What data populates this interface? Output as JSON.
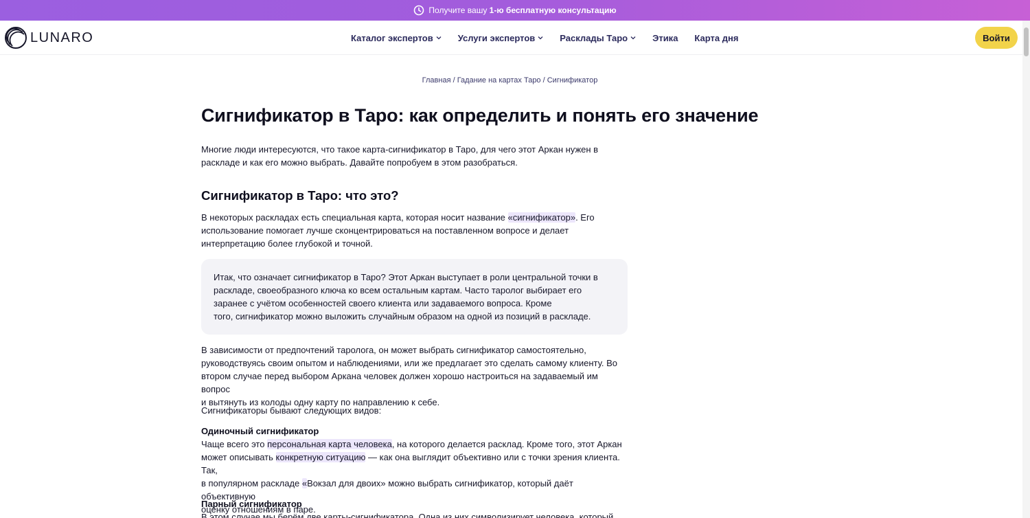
{
  "promo": {
    "prefix": "Получите вашу ",
    "bold": "1-ю бесплатную консультацию"
  },
  "header": {
    "logo_text": "LUNARO",
    "nav": [
      {
        "label": "Каталог экспертов",
        "dropdown": true
      },
      {
        "label": "Услуги экспертов",
        "dropdown": true
      },
      {
        "label": "Расклады Таро",
        "dropdown": true
      },
      {
        "label": "Этика",
        "dropdown": false
      },
      {
        "label": "Карта дня",
        "dropdown": false
      }
    ],
    "login_label": "Войти"
  },
  "breadcrumb": {
    "items": [
      "Главная",
      "Гадание на картах Таро",
      "Сигнификатор"
    ],
    "separator": " / "
  },
  "article": {
    "title": "Сигнификатор в Таро: как определить и понять его значение",
    "intro_1": "Многие люди интересуются, что такое карта-сигнификатор в Таро, для чего этот Аркан нужен в",
    "intro_2": "раскладе и как его можно выбрать. Давайте попробуем в этом разобраться.",
    "h2": "Сигнификатор в Таро: что это?",
    "p1_a": "В некоторых раскладах есть специальная карта, которая носит название ",
    "p1_hl": "«сигнификатор»",
    "p1_b": ". Его",
    "p1_2": "использование помогает лучше сконцентрироваться на поставленном вопросе и делает",
    "p1_3": "интерпретацию более глубокой и точной.",
    "callout_1": "Итак, что означает сигнификатор в Таро? Этот Аркан выступает в роли центральной точки в",
    "callout_2": "раскладе, своеобразного ключа ко всем остальным картам. Часто таролог выбирает его",
    "callout_3": "заранее с учётом особенностей своего клиента или задаваемого вопроса. Кроме",
    "callout_4": "того, сигнификатор можно выложить случайным образом на одной из позиций в раскладе.",
    "p2_1": "В зависимости от предпочтений таролога, он может выбрать сигнификатор самостоятельно,",
    "p2_2": "руководствуясь своим опытом и наблюдениями, или же предлагает это сделать самому клиенту. Во",
    "p2_3": "втором случае перед выбором Аркана человек должен хорошо настроиться на задаваемый им вопрос",
    "p2_4": "и вытянуть из колоды одну карту по направлению к себе.",
    "p3": "Сигнификаторы бывают следующих видов:",
    "sub1": "Одиночный сигнификатор",
    "s1_1a": "Чаще всего это ",
    "s1_1hl": "персональная карта человека",
    "s1_1b": ", на которого делается расклад. Кроме того, этот Аркан",
    "s1_2a": "может описывать ",
    "s1_2hl": "конкретную ситуацию",
    "s1_2b": " — как она выглядит объективно или с точки зрения клиента. Так,",
    "s1_3a": "в популярном раскладе ",
    "s1_3hl": "«",
    "s1_3b": "Вокзал для двоих» можно выбрать сигнификатор, который даёт объективную",
    "s1_4": "оценку отношениям в паре.",
    "sub2": "Парный сигнификатор",
    "s2_1": "В этом случае мы берём две карты-сигнификатора. Одна из них символизирует человека, который"
  },
  "colors": {
    "promo_gradient": [
      "#9b5fe0",
      "#c760d6"
    ],
    "login_button": "#f2d34a",
    "nav_text": "#2b2a5c",
    "highlight": "#ece6fb",
    "callout_bg": "#f3f3f7"
  },
  "icons": {
    "promo": "clock-icon",
    "logo": "lunaro-logo-icon",
    "nav_dropdown": "chevron-down-icon"
  }
}
